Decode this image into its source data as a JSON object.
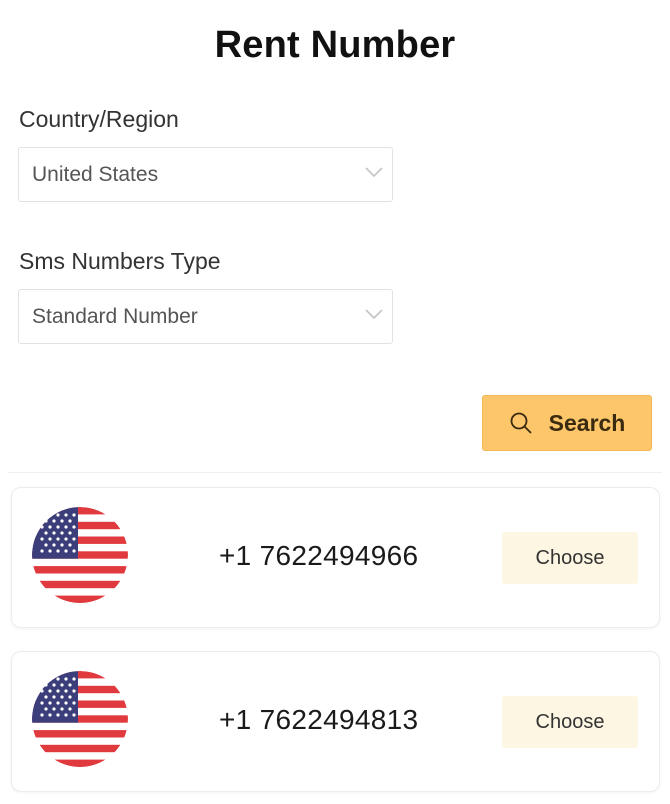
{
  "page": {
    "title": "Rent Number"
  },
  "form": {
    "country_label": "Country/Region",
    "country_value": "United States",
    "type_label": "Sms Numbers Type",
    "type_value": "Standard Number",
    "search_label": "Search"
  },
  "numbers": [
    {
      "phone": "+1 7622494966",
      "choose_label": "Choose",
      "flag": "us-flag-icon"
    },
    {
      "phone": "+1 7622494813",
      "choose_label": "Choose",
      "flag": "us-flag-icon"
    }
  ],
  "colors": {
    "search_button": "#fdc66a",
    "choose_button": "#fdf6e3"
  }
}
